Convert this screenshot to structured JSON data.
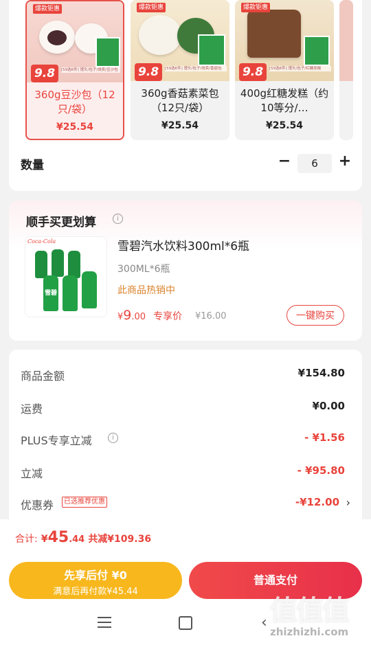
{
  "products": [
    {
      "badge_price": "9.8",
      "top_tag": "爆款钜惠",
      "desc": "[59选6件] 馒头/包子/烧卖/豆沙包",
      "name": "360g豆沙包（12只/袋）",
      "price": "¥25.54",
      "selected": true
    },
    {
      "badge_price": "9.8",
      "top_tag": "爆款钜惠",
      "desc": "[59选6件] 馒头/包子/烧卖/香菇包",
      "name": "360g香菇素菜包（12只/袋）",
      "price": "¥25.54",
      "selected": false
    },
    {
      "badge_price": "9.8",
      "top_tag": "爆款钜惠",
      "desc": "[59选6件] 馒头/包子/红糖发糕",
      "name": "400g红糖发糕（约10等分/…",
      "price": "¥25.54",
      "selected": false
    }
  ],
  "quantity": {
    "label": "数量",
    "minus": "−",
    "value": "6",
    "plus": "+"
  },
  "addon": {
    "title": "顺手买更划算",
    "product_name": "雪碧汽水饮料300ml*6瓶",
    "spec": "300ML*6瓶",
    "hot": "此商品热销中",
    "price_symbol": "¥",
    "price_int": "9",
    "price_dec": ".00",
    "price_tag": "专享价",
    "orig_price": "¥16.00",
    "buy_button": "一键购买",
    "brand": "Coca-Cola",
    "bottle_label": "雪碧"
  },
  "summary": {
    "rows": [
      {
        "label": "商品金额",
        "value": "¥154.80"
      },
      {
        "label": "运费",
        "value": "¥0.00"
      },
      {
        "label": "PLUS专享立减",
        "value": "- ¥1.56"
      },
      {
        "label": "立减",
        "value": "- ¥95.80"
      },
      {
        "label": "优惠券",
        "value": "-¥12.00",
        "tag": "已选推荐优惠"
      }
    ]
  },
  "total": {
    "label": "合计:",
    "symbol": "¥",
    "int": "45",
    "dec": ".44",
    "saved": "共减¥109.36"
  },
  "pay_later": {
    "title": "先享后付 ¥0",
    "subtitle": "满意后再付款¥45.44"
  },
  "pay_normal": "普通支付",
  "watermark": {
    "logo": "值值值",
    "site": "zhizhizhi.com"
  },
  "colors": {
    "accent": "#e8443c",
    "pay_later": "#f7b71d",
    "pay_normal": "#ec3640"
  }
}
